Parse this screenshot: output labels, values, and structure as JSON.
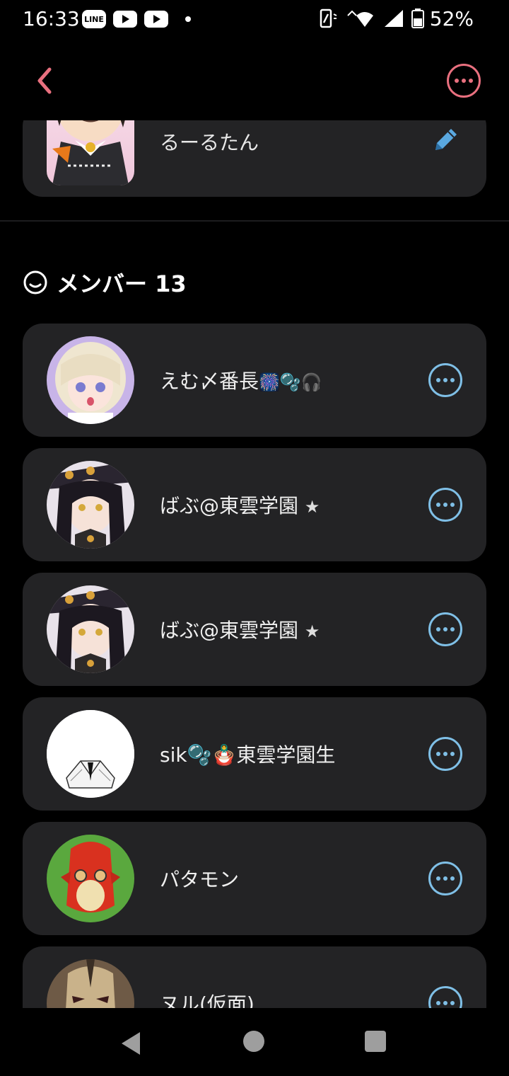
{
  "status": {
    "time": "16:33",
    "line_label": "LINE",
    "battery": "52%"
  },
  "section": {
    "title": "メンバー 13"
  },
  "owner": {
    "name": "るーるたん"
  },
  "members": [
    {
      "name": "えむ〆番長",
      "extra": "🎆🫧🎧"
    },
    {
      "name": "ばぶ@東雲学園",
      "extra": "★"
    },
    {
      "name": "ばぶ@東雲学園",
      "extra": "★"
    },
    {
      "name": "sik",
      "extra": "🫧🪆東雲学園生"
    },
    {
      "name": "パタモン",
      "extra": ""
    },
    {
      "name": "ヌル(仮面)",
      "extra": ""
    }
  ]
}
